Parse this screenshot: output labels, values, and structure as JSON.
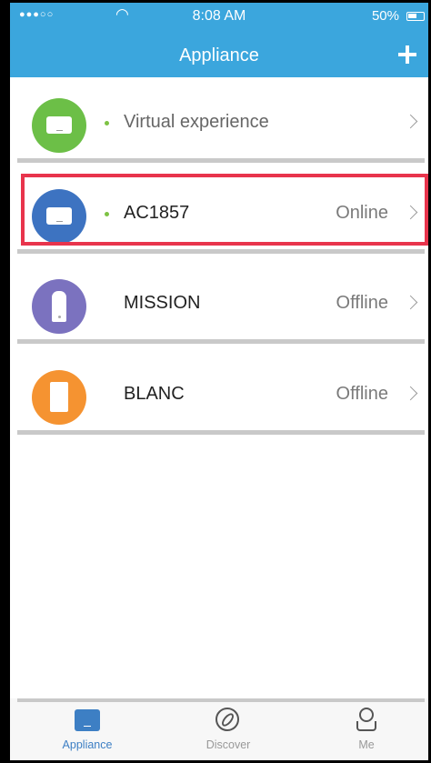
{
  "status_bar": {
    "signal": "●●●○○",
    "time": "8:08 AM",
    "battery": "50%"
  },
  "header": {
    "title": "Appliance"
  },
  "appliances": [
    {
      "name": "Virtual experience",
      "status": "",
      "color": "#6cbf47",
      "icon": "air-conditioner-icon"
    },
    {
      "name": "AC1857",
      "status": "Online",
      "color": "#3d73c1",
      "icon": "air-conditioner-icon"
    },
    {
      "name": "MISSION",
      "status": "Offline",
      "color": "#7b72bf",
      "icon": "dehumidifier-icon"
    },
    {
      "name": "BLANC",
      "status": "Offline",
      "color": "#f59331",
      "icon": "appliance-box-icon"
    }
  ],
  "tabs": [
    {
      "label": "Appliance",
      "icon": "appliance-icon",
      "active": true
    },
    {
      "label": "Discover",
      "icon": "compass-icon",
      "active": false
    },
    {
      "label": "Me",
      "icon": "person-icon",
      "active": false
    }
  ]
}
